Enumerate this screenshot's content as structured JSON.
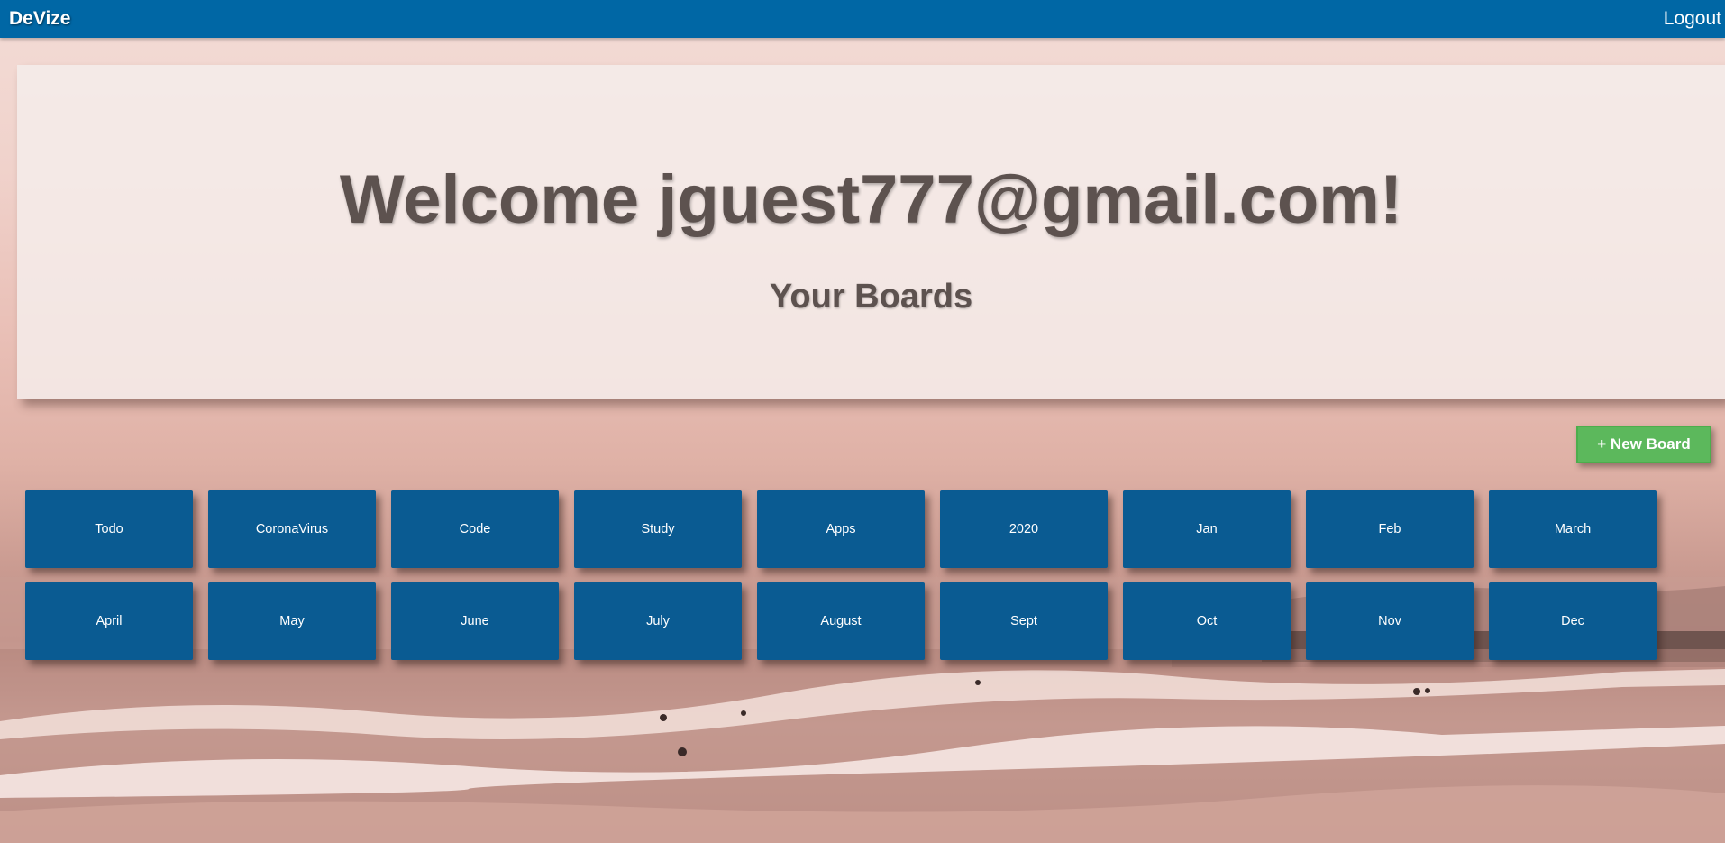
{
  "navbar": {
    "brand": "DeVize",
    "logout_label": "Logout"
  },
  "hero": {
    "welcome_text": "Welcome jguest777@gmail.com!",
    "subtitle": "Your Boards"
  },
  "actions": {
    "new_board_label": "+ New Board"
  },
  "boards": [
    {
      "name": "Todo"
    },
    {
      "name": "CoronaVirus"
    },
    {
      "name": "Code"
    },
    {
      "name": "Study"
    },
    {
      "name": "Apps"
    },
    {
      "name": "2020"
    },
    {
      "name": "Jan"
    },
    {
      "name": "Feb"
    },
    {
      "name": "March"
    },
    {
      "name": "April"
    },
    {
      "name": "May"
    },
    {
      "name": "June"
    },
    {
      "name": "July"
    },
    {
      "name": "August"
    },
    {
      "name": "Sept"
    },
    {
      "name": "Oct"
    },
    {
      "name": "Nov"
    },
    {
      "name": "Dec"
    }
  ],
  "colors": {
    "navbar": "#0067a5",
    "board_tile": "#0a5b92",
    "new_board_button": "#5cb85c",
    "heading_text": "#5d524f"
  }
}
